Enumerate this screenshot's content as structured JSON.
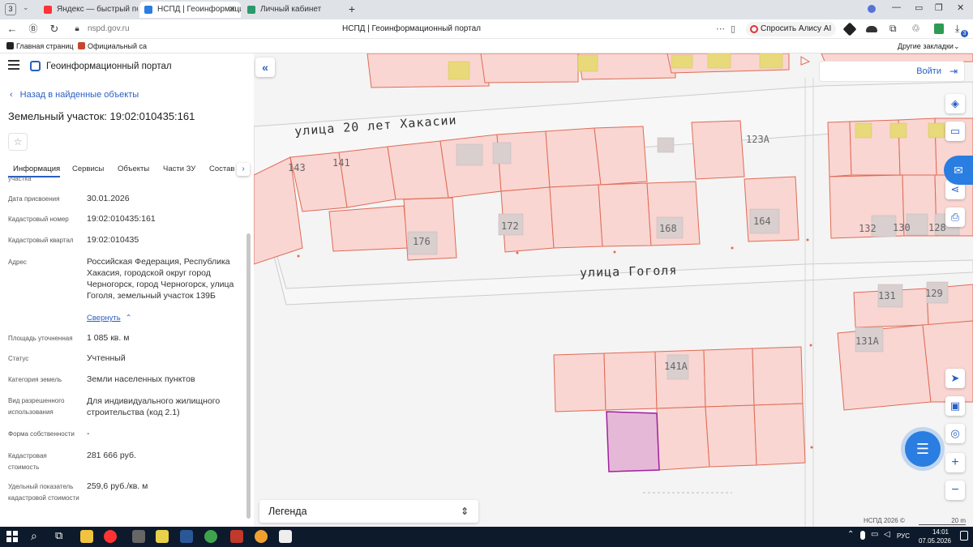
{
  "browser": {
    "tab_counter": "3",
    "tabs": [
      {
        "label": "Яндекс — быстрый поиск",
        "active": false
      },
      {
        "label": "НСПД | Геоинформаци",
        "active": true
      },
      {
        "label": "Личный кабинет",
        "active": false
      }
    ],
    "url": "nspd.gov.ru",
    "page_title": "НСПД | Геоинформационный портал",
    "alice_label": "Спросить Алису AI",
    "bookmarks": [
      "Главная страниц",
      "Официальный са"
    ],
    "other_bookmarks": "Другие закладки",
    "extension_badge": "3"
  },
  "app": {
    "title": "Геоинформационный портал",
    "back_link": "Назад в найденные объекты",
    "object_title": "Земельный участок: 19:02:010435:161",
    "tabs": [
      "Информация",
      "Сервисы",
      "Объекты",
      "Части ЗУ",
      "Состав"
    ],
    "cut_label": "участка"
  },
  "info": {
    "date": {
      "label": "Дата присвоения",
      "value": "30.01.2026"
    },
    "cadnum": {
      "label": "Кадастровый номер",
      "value": "19:02:010435:161"
    },
    "quarter": {
      "label": "Кадастровый квартал",
      "value": "19:02:010435"
    },
    "address": {
      "label": "Адрес",
      "value": "Российская Федерация, Республика Хакасия, городской округ город Черногорск, город Черногорск, улица Гоголя, земельный участок 139Б",
      "collapse": "Свернуть"
    },
    "area": {
      "label": "Площадь уточненная",
      "value": "1 085 кв. м"
    },
    "status": {
      "label": "Статус",
      "value": "Учтенный"
    },
    "category": {
      "label": "Категория земель",
      "value": "Земли населенных пунктов"
    },
    "use": {
      "label": "Вид разрешенного использования",
      "value": "Для индивидуального жилищного строительства (код 2.1)"
    },
    "ownership": {
      "label": "Форма собственности",
      "value": "-"
    },
    "cost": {
      "label": "Кадастровая стоимость",
      "value": "281 666 руб."
    },
    "specific": {
      "label": "Удельный показатель кадастровой стоимости",
      "value": "259,6 руб./кв. м"
    }
  },
  "map": {
    "login": "Войти",
    "legend": "Легенда",
    "streets": [
      "улица 20 лет Хакасии",
      "улица Гоголя"
    ],
    "house_numbers": [
      "143",
      "141",
      "176",
      "172",
      "168",
      "164",
      "123А",
      "132",
      "130",
      "128",
      "131",
      "129",
      "131А",
      "141А"
    ],
    "copyright": "НСПД 2026 ©",
    "scale": "20 m",
    "colors": {
      "parcel_fill": "#f9d6d2",
      "parcel_stroke": "#e06a55",
      "selected_fill": "#e6b8d8",
      "selected_stroke": "#a020a0",
      "building": "#e8d97a",
      "accent": "#2a5fc4"
    }
  },
  "taskbar": {
    "lang": "РУС",
    "time": "14:01",
    "date": "07.05.2026"
  }
}
